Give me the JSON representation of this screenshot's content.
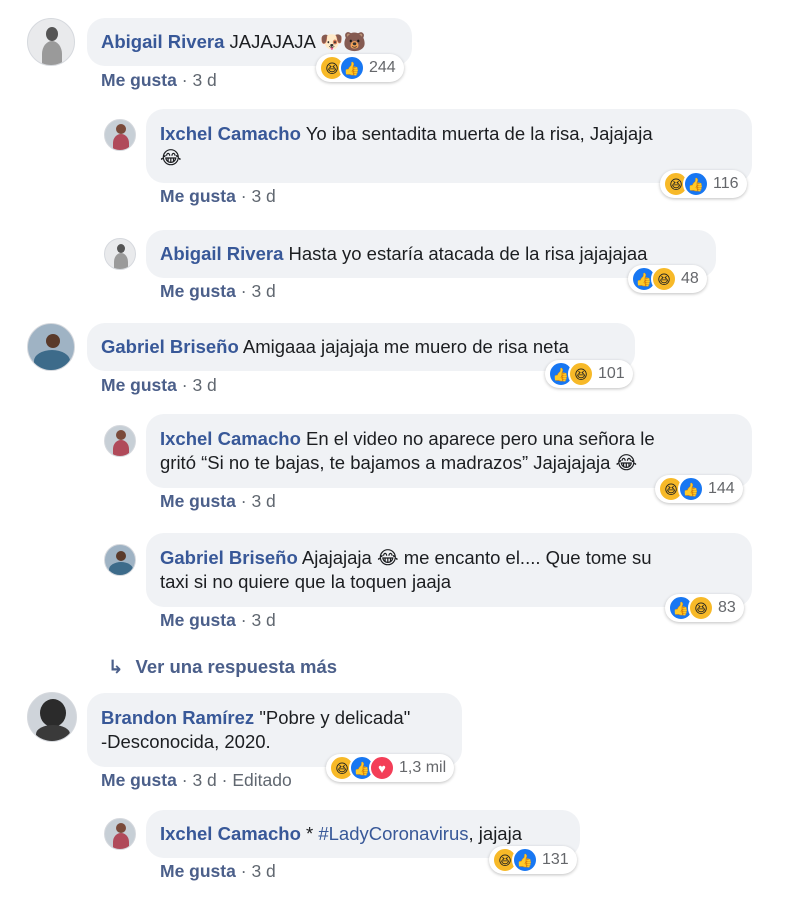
{
  "comments": [
    {
      "author": "Abigail Rivera",
      "text": "JAJAJAJA 🐶🐻",
      "like_label": "Me gusta",
      "time": "3 d",
      "reactions": [
        "haha",
        "like"
      ],
      "reaction_count": "244"
    },
    {
      "author": "Ixchel Camacho",
      "text_line1": "Yo iba sentadita muerta de la risa, Jajajaja",
      "text_line2": "😂",
      "like_label": "Me gusta",
      "time": "3 d",
      "reactions": [
        "haha",
        "like"
      ],
      "reaction_count": "116"
    },
    {
      "author": "Abigail Rivera",
      "text": "Hasta yo estaría atacada de la risa jajajajaa",
      "like_label": "Me gusta",
      "time": "3 d",
      "reactions": [
        "like",
        "haha"
      ],
      "reaction_count": "48"
    },
    {
      "author": "Gabriel Briseño",
      "text": "Amigaaa jajajaja me muero de risa neta",
      "like_label": "Me gusta",
      "time": "3 d",
      "reactions": [
        "like",
        "haha"
      ],
      "reaction_count": "101"
    },
    {
      "author": "Ixchel Camacho",
      "text_line1": "En el video no aparece pero una señora le",
      "text_line2": "gritó “Si no te bajas, te bajamos a madrazos” Jajajajaja 😂",
      "like_label": "Me gusta",
      "time": "3 d",
      "reactions": [
        "haha",
        "like"
      ],
      "reaction_count": "144"
    },
    {
      "author": "Gabriel Briseño",
      "text_line1": "Ajajajaja 😂 me encanto el.... Que tome su",
      "text_line2": "taxi si no quiere que la toquen jaaja",
      "like_label": "Me gusta",
      "time": "3 d",
      "reactions": [
        "like",
        "haha"
      ],
      "reaction_count": "83"
    },
    {
      "author": "Brandon Ramírez",
      "text_line1": "\"Pobre y delicada\"",
      "text_line2": "-Desconocida, 2020.",
      "like_label": "Me gusta",
      "time": "3 d",
      "edited": "Editado",
      "reactions": [
        "haha",
        "like",
        "love"
      ],
      "reaction_count": "1,3 mil"
    },
    {
      "author": "Ixchel Camacho",
      "text_prefix": "* ",
      "hashtag": "#LadyCoronavirus",
      "text_suffix": ", jajaja",
      "like_label": "Me gusta",
      "time": "3 d",
      "reactions": [
        "haha",
        "like"
      ],
      "reaction_count": "131"
    }
  ],
  "more_replies": {
    "icon": "reply-arrow-icon",
    "label": "Ver una respuesta más"
  },
  "colors": {
    "author": "#385898",
    "bubble": "#f0f2f5",
    "haha": "#f7b928",
    "like": "#1877f2",
    "love": "#f33e58"
  },
  "icons": {
    "haha": "😆",
    "like": "👍",
    "love": "♥"
  }
}
